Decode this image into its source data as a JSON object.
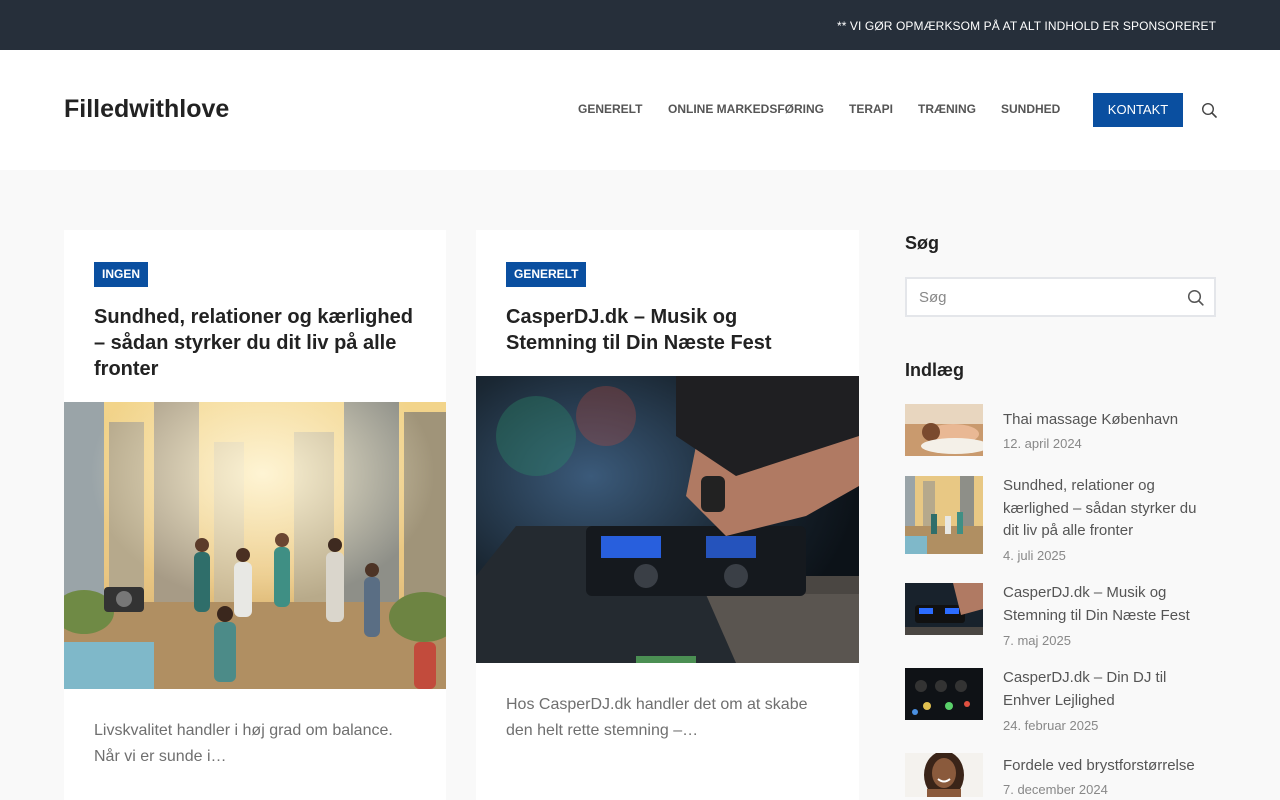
{
  "topbar": {
    "notice": "** VI GØR OPMÆRKSOM PÅ AT ALT INDHOLD ER SPONSORERET"
  },
  "header": {
    "logo": "Filledwithlove",
    "nav": [
      "GENERELT",
      "ONLINE MARKEDSFØRING",
      "TERAPI",
      "TRÆNING",
      "SUNDHED"
    ],
    "contact_label": "KONTAKT",
    "search_icon": "search-icon"
  },
  "posts": [
    {
      "category": "INGEN",
      "title": "Sundhed, relationer og kærlighed – sådan styrker du dit liv på alle fronter",
      "excerpt": "Livskvalitet handler i høj grad om balance. Når vi er sunde i…"
    },
    {
      "category": "GENERELT",
      "title": "CasperDJ.dk – Musik og Stemning til Din Næste Fest",
      "excerpt": "Hos CasperDJ.dk handler det om at skabe den helt rette stemning –…"
    }
  ],
  "sidebar": {
    "search_title": "Søg",
    "search_placeholder": "Søg",
    "posts_title": "Indlæg",
    "recent": [
      {
        "title": "Thai massage København",
        "date": "12. april 2024"
      },
      {
        "title": "Sundhed, relationer og kærlighed – sådan styrker du dit liv på alle fronter",
        "date": "4. juli 2025"
      },
      {
        "title": "CasperDJ.dk – Musik og Stemning til Din Næste Fest",
        "date": "7. maj 2025"
      },
      {
        "title": "CasperDJ.dk – Din DJ til Enhver Lejlighed",
        "date": "24. februar 2025"
      },
      {
        "title": "Fordele ved brystforstørrelse",
        "date": "7. december 2024"
      }
    ]
  },
  "colors": {
    "accent": "#0a4fa0",
    "topbar": "#262f3a"
  }
}
